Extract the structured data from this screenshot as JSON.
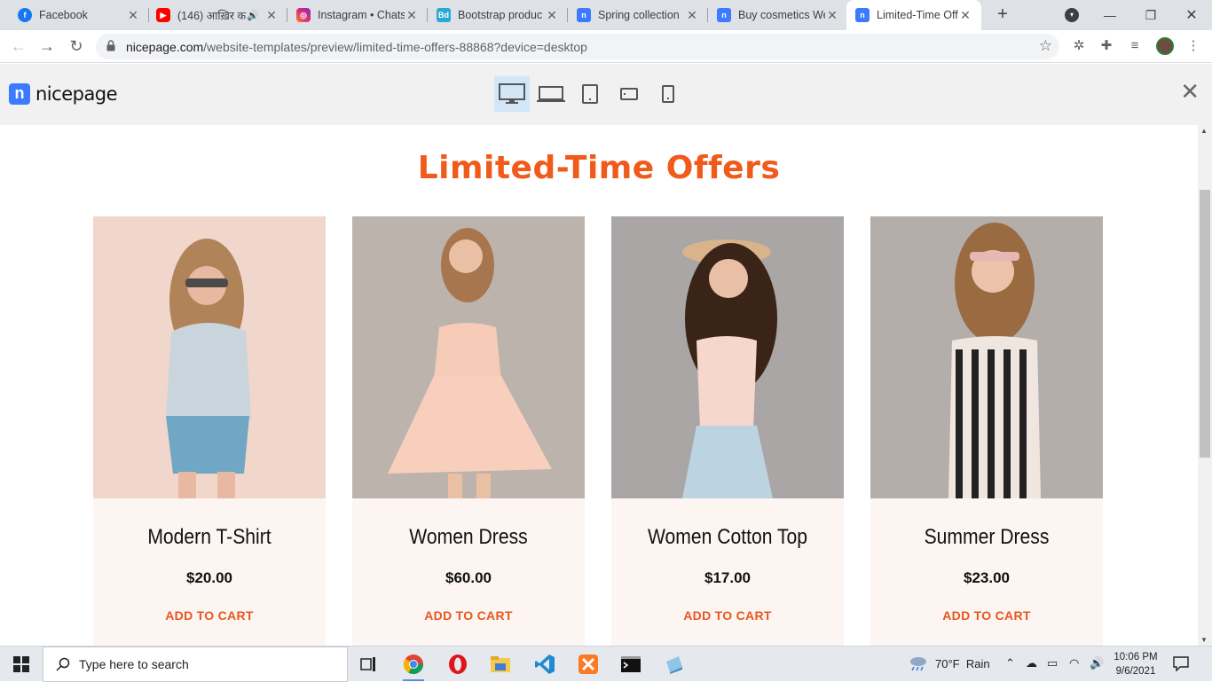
{
  "browser": {
    "tabs": [
      {
        "title": "Facebook",
        "favicon": "facebook-icon",
        "color": "#1877f2"
      },
      {
        "title": "(146) आख़िर क",
        "favicon": "youtube-icon",
        "color": "#ff0000"
      },
      {
        "title": "Instagram • Chats",
        "favicon": "instagram-icon",
        "color": "#d6249f"
      },
      {
        "title": "Bootstrap produc",
        "favicon": "bootstrap-icon",
        "color": "#2aa9d2"
      },
      {
        "title": "Spring collection",
        "favicon": "nicepage-icon",
        "color": "#3a7bff"
      },
      {
        "title": "Buy cosmetics We",
        "favicon": "nicepage-icon",
        "color": "#3a7bff"
      },
      {
        "title": "Limited-Time Offe",
        "favicon": "nicepage-icon",
        "color": "#3a7bff"
      }
    ],
    "active_tab": 6,
    "url_host": "nicepage.com",
    "url_path": "/website-templates/preview/limited-time-offers-88868?device=desktop"
  },
  "nicepage": {
    "logo_text": "nicepage",
    "devices": [
      "desktop",
      "laptop",
      "tablet",
      "tablet-landscape",
      "phone"
    ],
    "active_device": "desktop"
  },
  "page": {
    "heading": "Limited-Time Offers",
    "products": [
      {
        "name": "Modern T-Shirt",
        "price": "$20.00",
        "cta": "ADD TO CART"
      },
      {
        "name": "Women Dress",
        "price": "$60.00",
        "cta": "ADD TO CART"
      },
      {
        "name": "Women Cotton Top",
        "price": "$17.00",
        "cta": "ADD TO CART"
      },
      {
        "name": "Summer Dress",
        "price": "$23.00",
        "cta": "ADD TO CART"
      }
    ],
    "accent_color": "#f05a1a"
  },
  "taskbar": {
    "search_placeholder": "Type here to search",
    "weather": "70°F  Rain",
    "time": "10:06 PM",
    "date": "9/6/2021"
  }
}
